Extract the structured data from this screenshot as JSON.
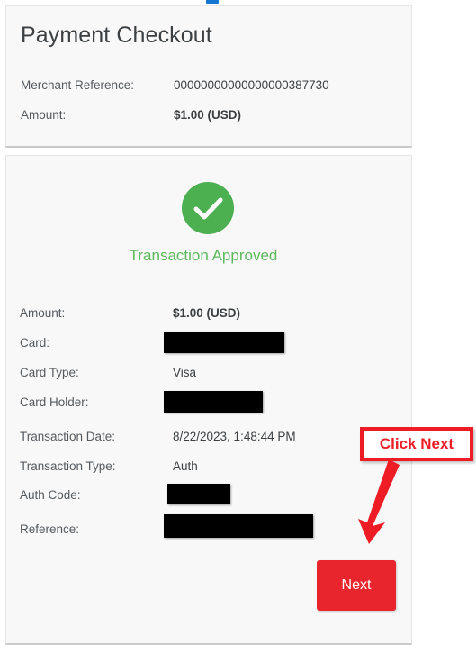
{
  "header_card": {
    "title": "Payment Checkout",
    "rows": [
      {
        "label": "Merchant Reference:",
        "value": "00000000000000000387730"
      },
      {
        "label": "Amount:",
        "value": "$1.00 (USD)"
      }
    ]
  },
  "result_card": {
    "status": {
      "icon": "check-circle-icon",
      "text": "Transaction Approved",
      "color": "#5cb85c"
    },
    "rows": [
      {
        "label": "Amount:",
        "value": "$1.00 (USD)"
      },
      {
        "label": "Card:",
        "value": ""
      },
      {
        "label": "Card Type:",
        "value": "Visa"
      },
      {
        "label": "Card Holder:",
        "value": ""
      },
      {
        "label": "Transaction Date:",
        "value": "8/22/2023, 1:48:44 PM"
      },
      {
        "label": "Transaction Type:",
        "value": "Auth"
      },
      {
        "label": "Auth Code:",
        "value": ""
      },
      {
        "label": "Reference:",
        "value": ""
      }
    ],
    "next_button": {
      "label": "Next",
      "color": "#e8242c"
    }
  },
  "annotation": {
    "label": "Click Next",
    "color": "#ee1c25",
    "arrow_icon": "down-left-arrow-icon"
  }
}
